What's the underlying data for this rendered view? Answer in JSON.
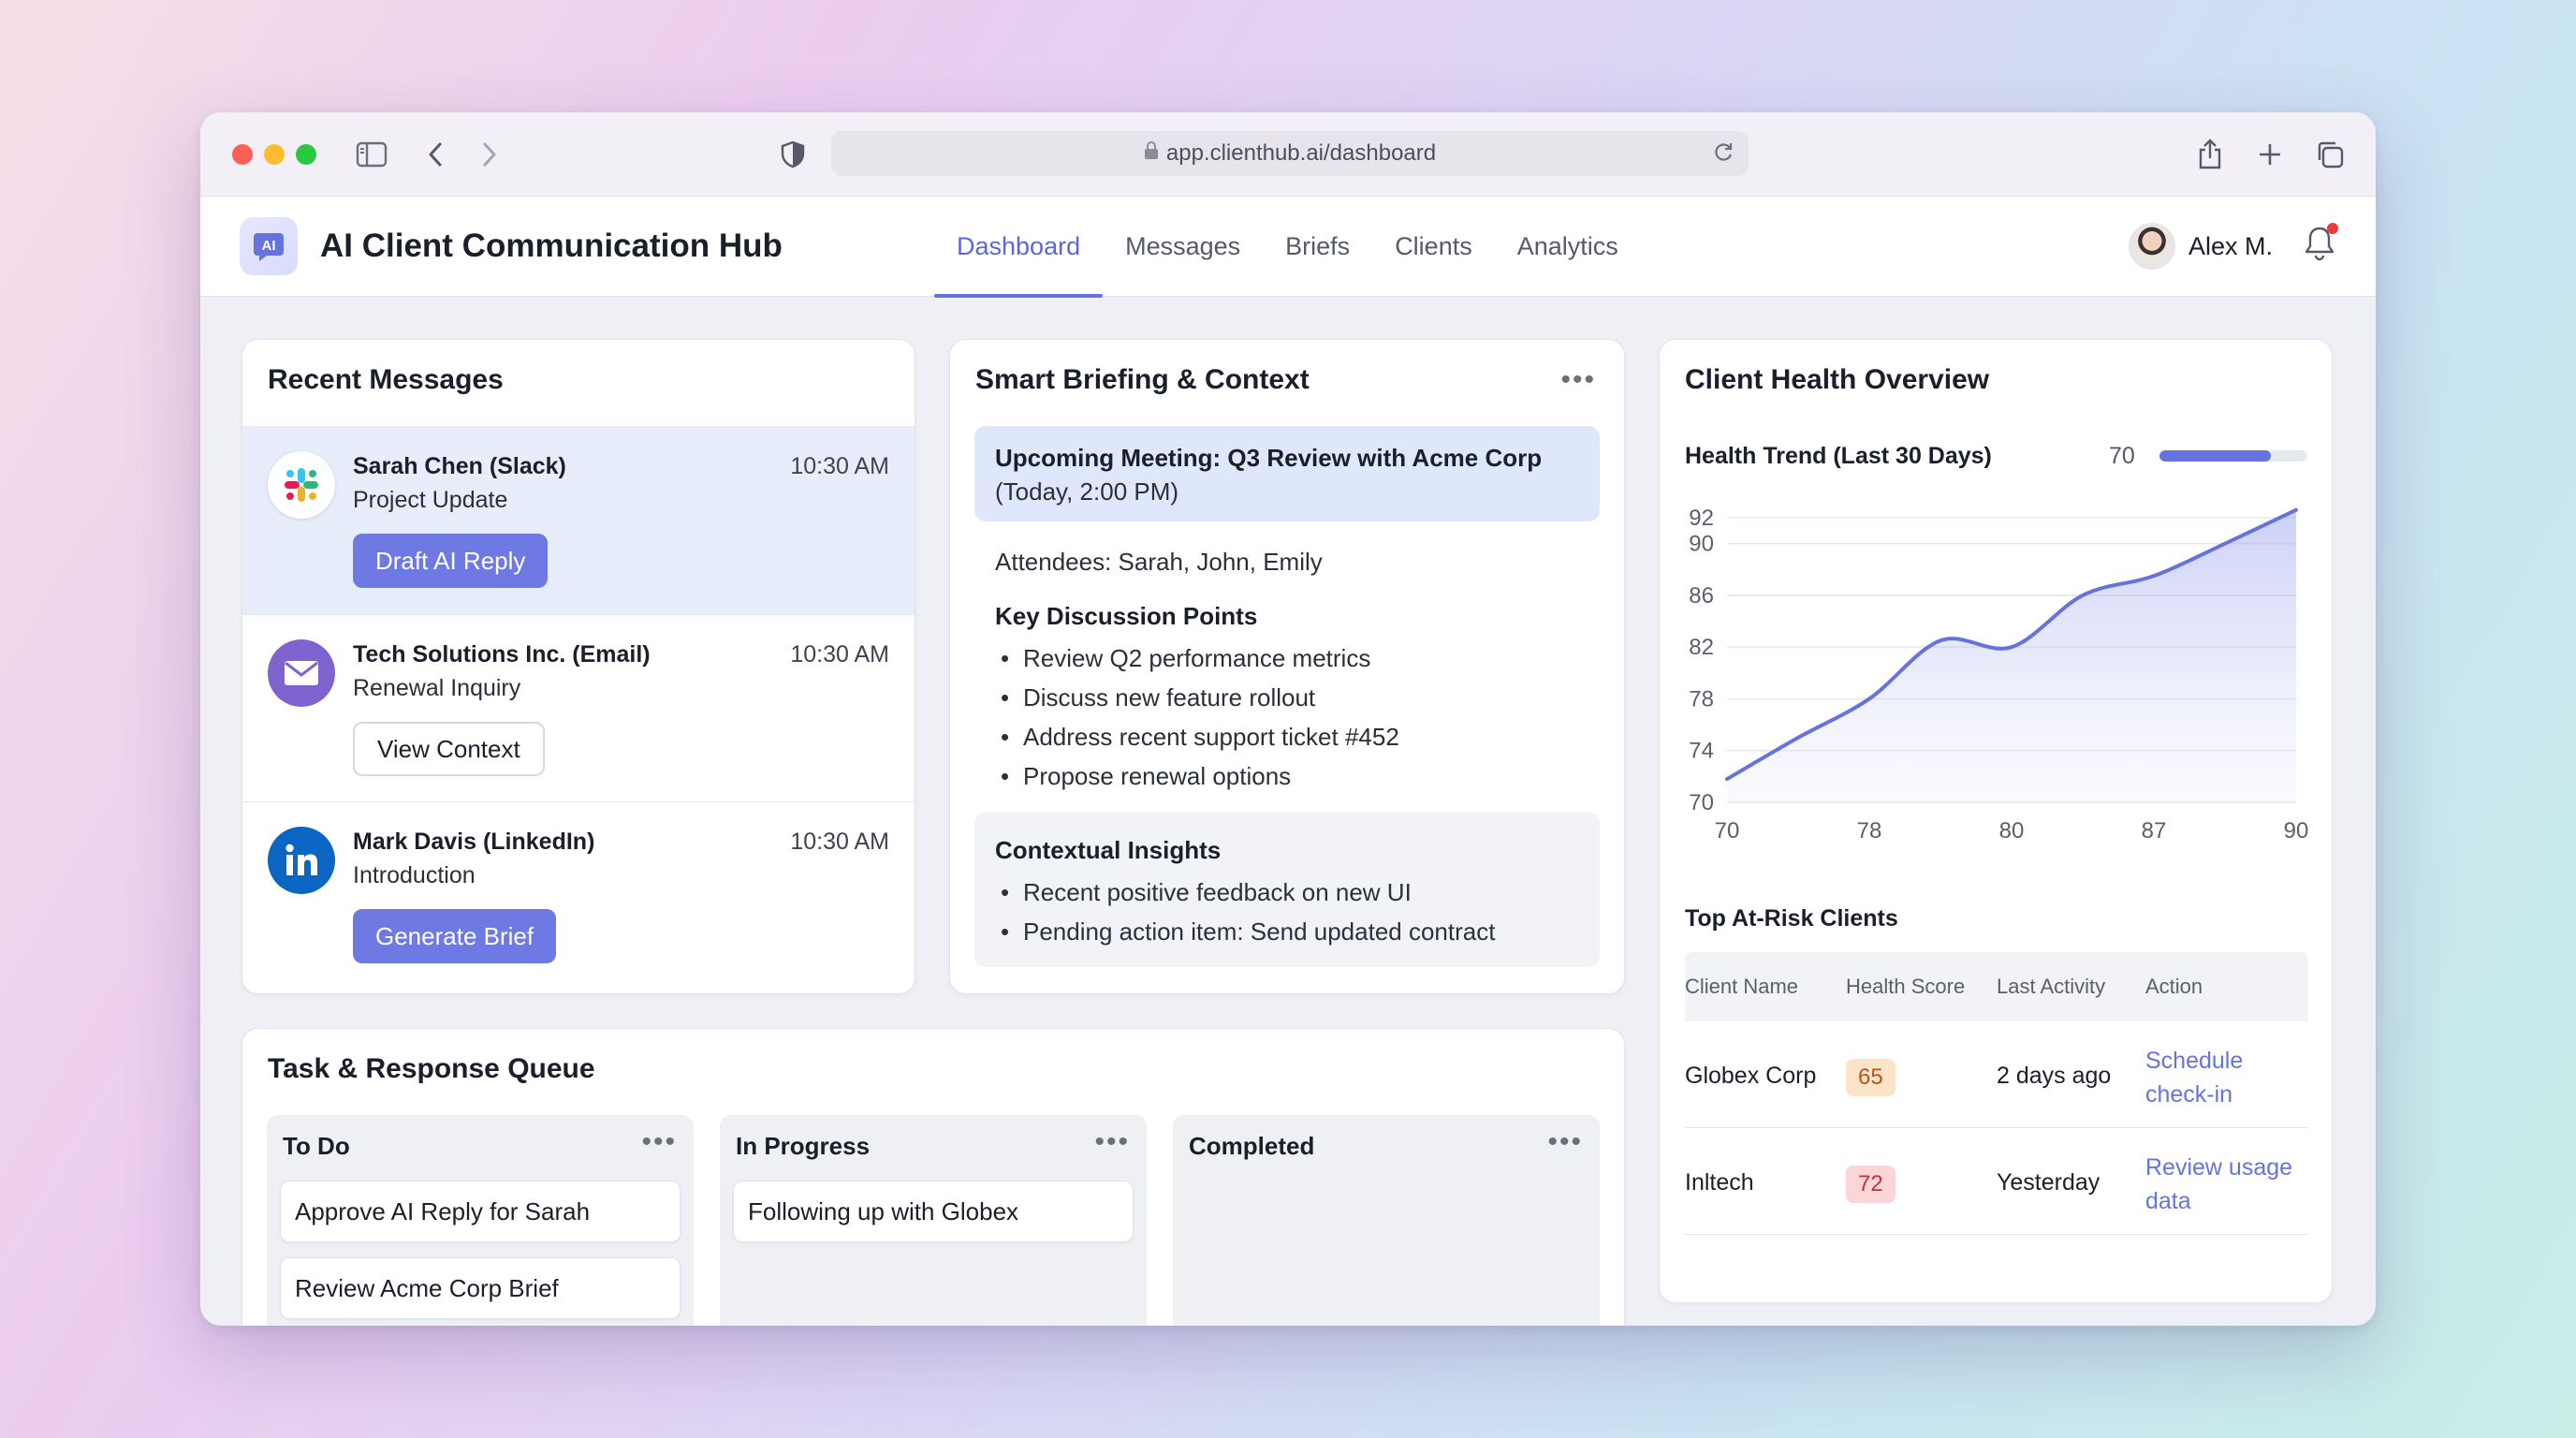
{
  "browser": {
    "url": "app.clienthub.ai/dashboard"
  },
  "app": {
    "title": "AI Client Communication Hub",
    "nav": [
      "Dashboard",
      "Messages",
      "Briefs",
      "Clients",
      "Analytics"
    ],
    "active_nav": "Dashboard",
    "user_name": "Alex M.",
    "accent_color": "#6673de"
  },
  "recent_messages": {
    "title": "Recent Messages",
    "items": [
      {
        "from": "Sarah Chen (Slack)",
        "subject": "Project Update",
        "time": "10:30 AM",
        "action": "Draft AI Reply",
        "icon": "slack-icon"
      },
      {
        "from": "Tech Solutions Inc. (Email)",
        "subject": "Renewal Inquiry",
        "time": "10:30 AM",
        "action": "View Context",
        "icon": "mail-icon"
      },
      {
        "from": "Mark Davis (LinkedIn)",
        "subject": "Introduction",
        "time": "10:30 AM",
        "action": "Generate Brief",
        "icon": "linkedin-icon"
      }
    ]
  },
  "briefing": {
    "title": "Smart Briefing & Context",
    "meeting_title": "Upcoming Meeting: Q3 Review with Acme Corp",
    "meeting_time": "(Today, 2:00 PM)",
    "attendees": "Attendees: Sarah, John, Emily",
    "key_points_title": "Key Discussion Points",
    "key_points": [
      "Review Q2 performance metrics",
      "Discuss new feature rollout",
      "Address recent support ticket #452",
      "Propose renewal options"
    ],
    "insights_title": "Contextual Insights",
    "insights": [
      "Recent positive feedback on new UI",
      "Pending action item: Send updated contract"
    ]
  },
  "task_queue": {
    "title": "Task & Response Queue",
    "columns": [
      {
        "title": "To Do",
        "tasks": [
          "Approve AI Reply for Sarah",
          "Review Acme Corp Brief"
        ]
      },
      {
        "title": "In Progress",
        "tasks": [
          "Following up with Globex"
        ]
      },
      {
        "title": "Completed",
        "tasks": []
      }
    ]
  },
  "client_health": {
    "title": "Client Health Overview",
    "trend_label": "Health Trend (Last 30 Days)",
    "trend_value": "70",
    "trend_fill_fraction": 0.75,
    "at_risk_title": "Top At-Risk Clients",
    "table_headers": [
      "Client Name",
      "Health Score",
      "Last Activity",
      "Action"
    ],
    "rows": [
      {
        "name": "Globex Corp",
        "score": "65",
        "score_bg": "#fde4c8",
        "score_fg": "#b2581a",
        "activity": "2 days ago",
        "action_line1": "Schedule",
        "action_line2": "check-in"
      },
      {
        "name": "Inltech",
        "score": "72",
        "score_bg": "#fbd5d8",
        "score_fg": "#c2323c",
        "activity": "Yesterday",
        "action_line1": "Review usage",
        "action_line2": "data"
      }
    ]
  },
  "chart_data": {
    "type": "area",
    "title": "Health Trend (Last 30 Days)",
    "x_tick_labels": [
      "70",
      "78",
      "80",
      "87",
      "90"
    ],
    "y_ticks": [
      70,
      74,
      78,
      82,
      86,
      90,
      92
    ],
    "ylim": [
      70,
      92
    ],
    "x": [
      0,
      0.5,
      1,
      1.5,
      2,
      2.5,
      3,
      3.5,
      4
    ],
    "series": [
      {
        "values": [
          71.8,
          75.0,
          78.0,
          82.5,
          82.0,
          86.0,
          87.5,
          90.0,
          92.6
        ]
      }
    ],
    "grid": true,
    "color": "#6673de"
  }
}
